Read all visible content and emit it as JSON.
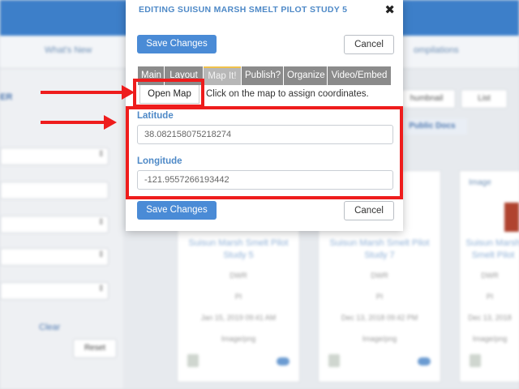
{
  "background": {
    "nav_links": [
      "What's New",
      "ompilations"
    ],
    "sidebar_label": "ER",
    "clear_label": "Clear",
    "reset_label": "Reset",
    "thumbnail_label": "humbnail",
    "list_label": "List",
    "public_docs_label": "Public Docs",
    "image_label": "Image",
    "cards": [
      {
        "title": "Suisun Marsh Smelt Pilot Study 5",
        "source": "DWR",
        "code": "PI",
        "date": "Jan 15, 2019 09:41 AM",
        "type": "Image/png"
      },
      {
        "title": "Suisun Marsh Smelt Pilot Study 7",
        "source": "DWR",
        "code": "PI",
        "date": "Dec 13, 2018 09:42 PM",
        "type": "Image/png"
      },
      {
        "title": "Suisun Marsh Smelt Pilot",
        "source": "DWR",
        "code": "PI",
        "date": "Dec 13, 2018",
        "type": "Image/png"
      }
    ]
  },
  "modal": {
    "title": "EDITING SUISUN MARSH SMELT PILOT STUDY 5",
    "close_glyph": "✖",
    "save_label": "Save Changes",
    "cancel_label": "Cancel",
    "tabs": [
      {
        "label": "Main",
        "active": false
      },
      {
        "label": "Layout",
        "active": false
      },
      {
        "label": "Map It!",
        "active": true
      },
      {
        "label": "Publish?",
        "active": false
      },
      {
        "label": "Organize",
        "active": false
      },
      {
        "label": "Video/Embed",
        "active": false
      }
    ],
    "open_map_label": "Open Map",
    "hint_text": "Click on the map to assign coordinates.",
    "latitude_label": "Latitude",
    "latitude_value": "38.082158075218274",
    "longitude_label": "Longitude",
    "longitude_value": "-121.9557266193442"
  },
  "colors": {
    "accent": "#4e89c7",
    "primary_button": "#4a8bd6",
    "annotation_red": "#ee1c1c",
    "tab_bg": "#8b8b8b",
    "tab_active_border": "#f0c14b"
  }
}
